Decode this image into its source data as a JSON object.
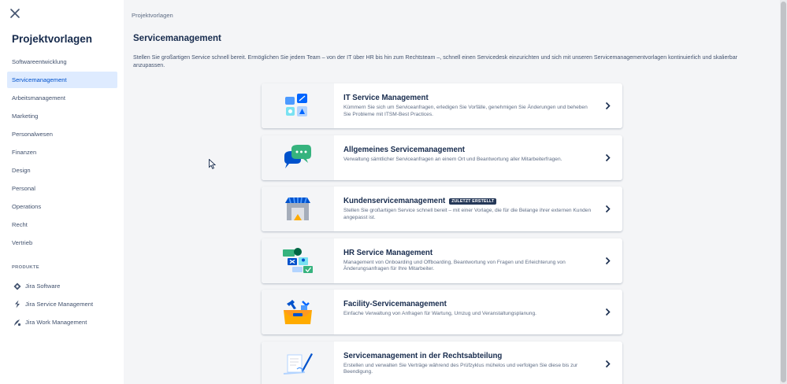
{
  "sidebar": {
    "title": "Projektvorlagen",
    "items": [
      {
        "label": "Softwareentwicklung"
      },
      {
        "label": "Servicemanagement",
        "active": true
      },
      {
        "label": "Arbeitsmanagement"
      },
      {
        "label": "Marketing"
      },
      {
        "label": "Personalwesen"
      },
      {
        "label": "Finanzen"
      },
      {
        "label": "Design"
      },
      {
        "label": "Personal"
      },
      {
        "label": "Operations"
      },
      {
        "label": "Recht"
      },
      {
        "label": "Vertrieb"
      }
    ],
    "products_heading": "PRODUKTE",
    "products": [
      {
        "label": "Jira Software",
        "icon": "jira-software-icon"
      },
      {
        "label": "Jira Service Management",
        "icon": "jira-service-management-icon"
      },
      {
        "label": "Jira Work Management",
        "icon": "jira-work-management-icon"
      }
    ]
  },
  "main": {
    "breadcrumb": "Projektvorlagen",
    "title": "Servicemanagement",
    "description": "Stellen Sie großartigen Service schnell bereit. Ermöglichen Sie jedem Team – von der IT über HR bis hin zum Rechtsteam –, schnell einen Servicedesk einzurichten und sich mit unseren Servicemanagementvorlagen kontinuierlich und skalierbar anzupassen.",
    "templates": [
      {
        "title": "IT Service Management",
        "description": "Kümmern Sie sich um Serviceanfragen, erledigen Sie Vorfälle, genehmigen Sie Änderungen und beheben Sie Probleme mit ITSM-Best Practices.",
        "badge": "",
        "icon": "it-service-illustration-icon"
      },
      {
        "title": "Allgemeines Servicemanagement",
        "description": "Verwaltung sämtlicher Serviceanfragen an einem Ort und Beantwortung aller Mitarbeiterfragen.",
        "badge": "",
        "icon": "chat-bubbles-illustration-icon"
      },
      {
        "title": "Kundenservicemanagement",
        "description": "Stellen Sie großartigen Service schnell bereit – mit einer Vorlage, die für die Belange ihrer externen Kunden angepasst ist.",
        "badge": "ZULETZT ERSTELLT",
        "icon": "storefront-illustration-icon"
      },
      {
        "title": "HR Service Management",
        "description": "Management von Onboarding und Offboarding, Beantwortung von Fragen und Erleichterung von Änderungsanfragen für Ihre Mitarbeiter.",
        "badge": "",
        "icon": "hr-people-illustration-icon"
      },
      {
        "title": "Facility-Servicemanagement",
        "description": "Einfache Verwaltung von Anfragen für Wartung, Umzug und Veranstaltungsplanung.",
        "badge": "",
        "icon": "toolbox-illustration-icon"
      },
      {
        "title": "Servicemanagement in der Rechtsabteilung",
        "description": "Erstellen und verwalten Sie Verträge während des Prüfzyklus mühelos und verfolgen Sie diese bis zur Beendigung.",
        "badge": "",
        "icon": "legal-document-illustration-icon"
      }
    ]
  },
  "colors": {
    "accent": "#0052cc",
    "active_bg": "#deebff",
    "badge_bg": "#253858",
    "text": "#172b4d"
  }
}
